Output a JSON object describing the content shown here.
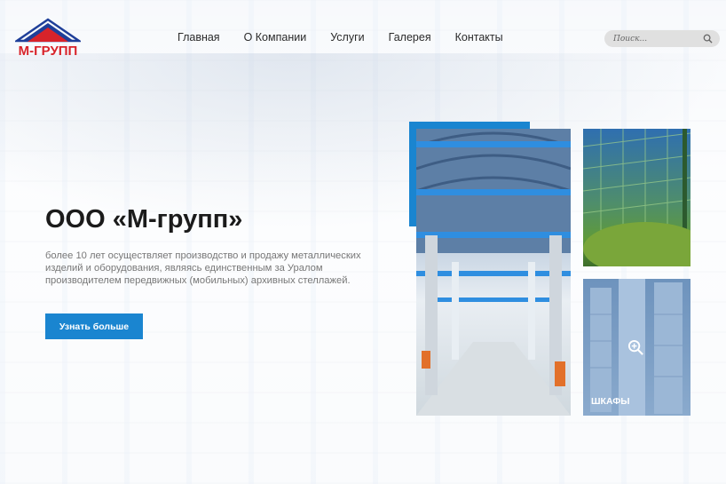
{
  "logo": {
    "text": "М-ГРУПП",
    "roof_color": "#d8232a",
    "outline_color": "#1f3f99"
  },
  "nav": {
    "items": [
      {
        "label": "Главная"
      },
      {
        "label": "О Компании"
      },
      {
        "label": "Услуги"
      },
      {
        "label": "Галерея"
      },
      {
        "label": "Контакты"
      }
    ]
  },
  "search": {
    "placeholder": "Поиск...",
    "icon": "search-icon"
  },
  "hero": {
    "title": "ООО «М-групп»",
    "description": "более 10 лет осуществляет производство и продажу металлических изделий и оборудования, являясь единственным за Уралом производителем передвижных (мобильных) архивных стеллажей.",
    "button_label": "Узнать больше"
  },
  "gallery": {
    "shelves_label": "ШКАФЫ",
    "zoom_icon": "zoom-in-icon"
  },
  "colors": {
    "accent": "#1a85d0",
    "brand_red": "#d8232a"
  }
}
